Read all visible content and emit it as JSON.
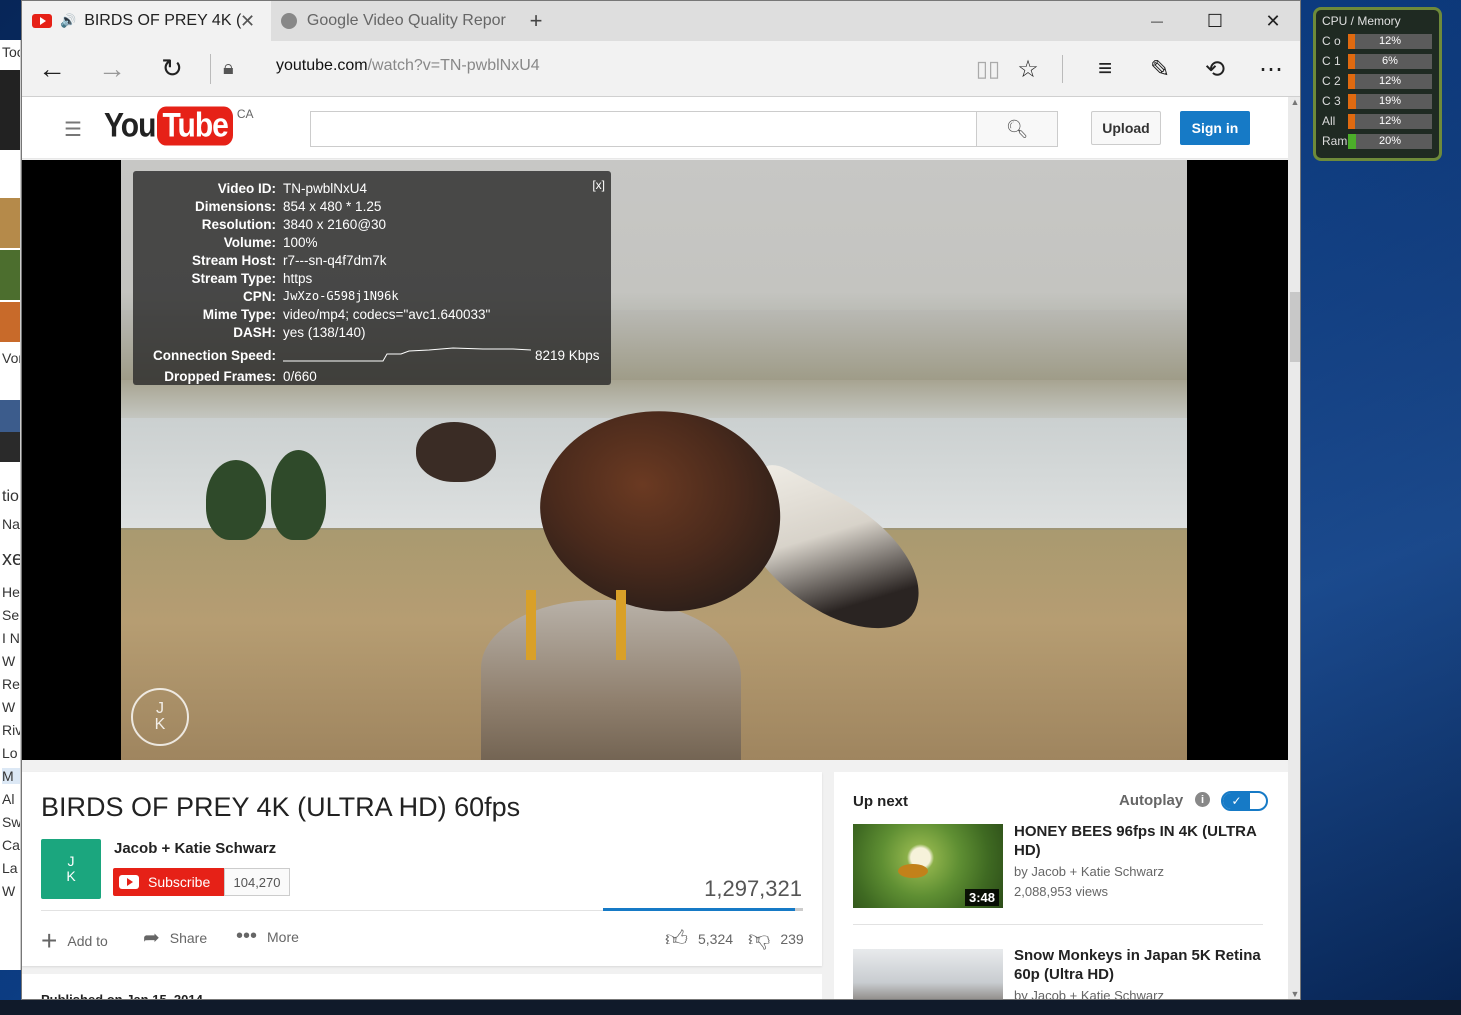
{
  "browser": {
    "tabs": [
      {
        "title": "BIRDS OF PREY 4K (",
        "active": true
      },
      {
        "title": "Google Video Quality Report",
        "active": false
      }
    ],
    "new_tab": "+",
    "window_controls": {
      "minimize": "—",
      "maximize": "☐",
      "close": "✕"
    },
    "url_host": "youtube.com",
    "url_path": "/watch?v=TN-pwblNxU4"
  },
  "cpu_gadget": {
    "title": "CPU / Memory",
    "rows": [
      {
        "label": "C o",
        "value": "12%",
        "level": 0.12
      },
      {
        "label": "C 1",
        "value": "6%",
        "level": 0.06
      },
      {
        "label": "C 2",
        "value": "12%",
        "level": 0.12
      },
      {
        "label": "C 3",
        "value": "19%",
        "level": 0.19
      },
      {
        "label": "All",
        "value": "12%",
        "level": 0.12
      },
      {
        "label": "Ram",
        "value": "20%",
        "level": 0.2
      }
    ]
  },
  "background_app": {
    "fragments": [
      "Too",
      "Vorl",
      "tio",
      "Na",
      "xe",
      "He",
      "Se",
      "I N",
      "W",
      "Re",
      "W",
      "Riv",
      "Lo",
      "M",
      "Al",
      "Sw",
      "Ca",
      "La",
      "W"
    ]
  },
  "youtube": {
    "logo_you": "You",
    "logo_tube": "Tube",
    "country": "CA",
    "search_placeholder": "",
    "upload": "Upload",
    "sign_in": "Sign in"
  },
  "stats": {
    "close": "[x]",
    "rows": [
      {
        "key": "Video ID:",
        "value": "TN-pwblNxU4"
      },
      {
        "key": "Dimensions:",
        "value": "854 x 480 * 1.25"
      },
      {
        "key": "Resolution:",
        "value": "3840 x 2160@30"
      },
      {
        "key": "Volume:",
        "value": "100%"
      },
      {
        "key": "Stream Host:",
        "value": "r7---sn-q4f7dm7k"
      },
      {
        "key": "Stream Type:",
        "value": "https"
      },
      {
        "key": "CPN:",
        "value": "JwXzo-G598j1N96k"
      },
      {
        "key": "Mime Type:",
        "value": "video/mp4; codecs=\"avc1.640033\""
      },
      {
        "key": "DASH:",
        "value": "yes (138/140)"
      }
    ],
    "speed_key": "Connection Speed:",
    "speed_value": "8219 Kbps",
    "frames_key": "Dropped Frames:",
    "frames_value": "0/660"
  },
  "watermark": {
    "top": "J",
    "bottom": "K"
  },
  "video": {
    "title": "BIRDS OF PREY 4K (ULTRA HD) 60fps",
    "channel": "Jacob + Katie Schwarz",
    "subscribe": "Subscribe",
    "subscriber_count": "104,270",
    "views": "1,297,321",
    "add_to": "Add to",
    "share": "Share",
    "more": "More",
    "likes": "5,324",
    "dislikes": "239",
    "published": "Published on Jan 15, 2014"
  },
  "sidebar": {
    "up_next": "Up next",
    "autoplay": "Autoplay",
    "autoplay_on": true,
    "items": [
      {
        "title": "HONEY BEES 96fps IN 4K (ULTRA HD)",
        "by": "by Jacob + Katie Schwarz",
        "views": "2,088,953 views",
        "duration": "3:48"
      },
      {
        "title": "Snow Monkeys in Japan 5K Retina 60p (Ultra HD)",
        "by": "by Jacob + Katie Schwarz",
        "views": "",
        "duration": ""
      }
    ]
  }
}
